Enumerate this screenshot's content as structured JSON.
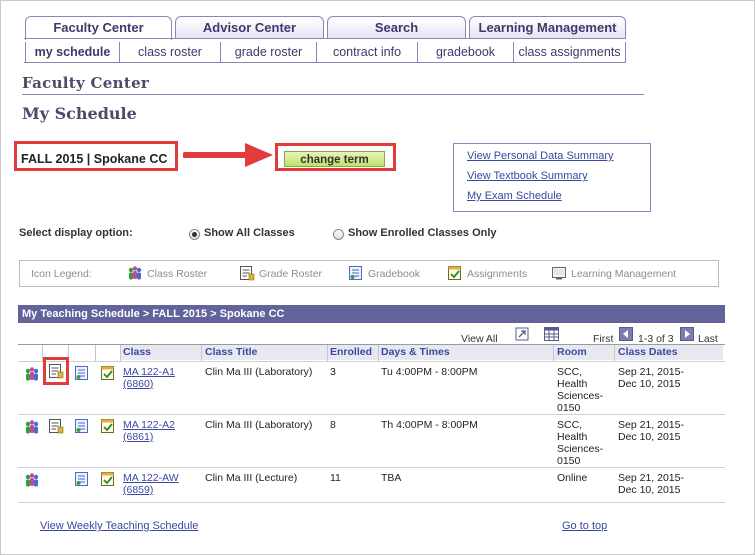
{
  "tabs": [
    "Faculty Center",
    "Advisor Center",
    "Search",
    "Learning Management"
  ],
  "subtabs": [
    "my schedule",
    "class roster",
    "grade roster",
    "contract info",
    "gradebook",
    "class assignments"
  ],
  "section_title": "Faculty Center",
  "page_title": "My Schedule",
  "term_label": "FALL 2015 | Spokane CC",
  "change_term_label": "change term",
  "links": [
    "View Personal Data Summary",
    "View Textbook Summary",
    "My Exam Schedule"
  ],
  "display_option": {
    "label": "Select display option:",
    "all": "Show All Classes",
    "enrolled": "Show Enrolled Classes Only",
    "selected": "all"
  },
  "legend": {
    "title": "Icon Legend:",
    "items": [
      "Class Roster",
      "Grade Roster",
      "Gradebook",
      "Assignments",
      "Learning Management"
    ]
  },
  "grid": {
    "title": "My Teaching Schedule > FALL 2015 > Spokane CC",
    "view_all": "View All",
    "first": "First",
    "range": "1-3 of 3",
    "last": "Last",
    "columns": [
      "Class",
      "Class Title",
      "Enrolled",
      "Days & Times",
      "Room",
      "Class Dates"
    ],
    "rows": [
      {
        "class_line1": "MA 122-A1",
        "class_line2": "(6860)",
        "title": "Clin Ma III (Laboratory)",
        "enrolled": "3",
        "days_times": "Tu 4:00PM - 8:00PM",
        "room": [
          "SCC,",
          "Health",
          "Sciences-",
          "0150"
        ],
        "dates": [
          "Sep 21, 2015-",
          "Dec 10, 2015"
        ]
      },
      {
        "class_line1": "MA 122-A2",
        "class_line2": "(6861)",
        "title": "Clin Ma III (Laboratory)",
        "enrolled": "8",
        "days_times": "Th 4:00PM - 8:00PM",
        "room": [
          "SCC,",
          "Health",
          "Sciences-",
          "0150"
        ],
        "dates": [
          "Sep 21, 2015-",
          "Dec 10, 2015"
        ]
      },
      {
        "class_line1": "MA 122-AW",
        "class_line2": "(6859)",
        "title": "Clin Ma III (Lecture)",
        "enrolled": "11",
        "days_times": "TBA",
        "room": [
          "Online"
        ],
        "dates": [
          "Sep 21, 2015-",
          "Dec 10, 2015"
        ]
      }
    ]
  },
  "footer": {
    "weekly": "View Weekly Teaching Schedule",
    "top": "Go to top"
  },
  "colors": {
    "highlight": "#e23b3b",
    "header_bar": "#63639b",
    "link": "#3b48a0",
    "button": "#bfe26a"
  }
}
